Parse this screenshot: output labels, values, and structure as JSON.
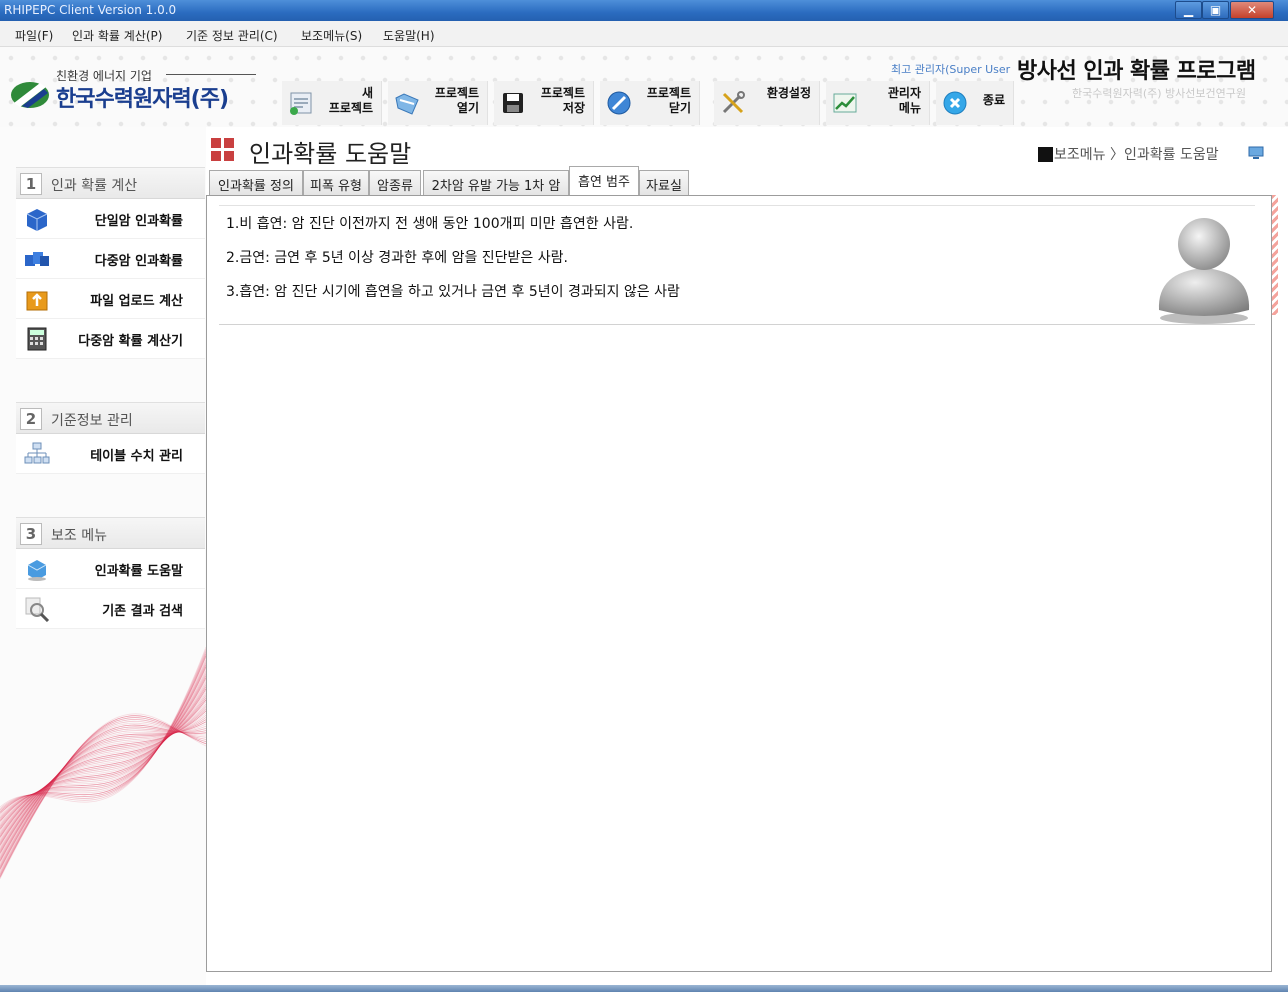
{
  "window": {
    "title": "RHIPEPC Client Version 1.0.0",
    "min_glyph": "▁",
    "max_glyph": "▣",
    "close_glyph": "✕"
  },
  "menubar": [
    "파일(F)",
    "인과 확률 계산(P)",
    "기준 정보 관리(C)",
    "보조메뉴(S)",
    "도움말(H)"
  ],
  "header": {
    "logo_tagline": "친환경 에너지 기업",
    "logo_name": "한국수력원자력(주)",
    "user_label": "최고 관리자(Super User",
    "program_title": "방사선 인과 확률 프로그램",
    "program_subtitle": "한국수력원자력(주) 방사선보건연구원"
  },
  "toolbar": [
    {
      "label": "새\n프로젝트",
      "icon": "new-project-icon"
    },
    {
      "label": "프로젝트\n열기",
      "icon": "open-folder-icon"
    },
    {
      "label": "프로젝트\n저장",
      "icon": "save-disk-icon"
    },
    {
      "label": "프로젝트\n닫기",
      "icon": "close-circle-icon"
    },
    {
      "label": "환경설정",
      "icon": "tools-icon"
    },
    {
      "label": "관리자\n메뉴",
      "icon": "chart-icon"
    },
    {
      "label": "종료",
      "icon": "exit-icon"
    }
  ],
  "sidebar": {
    "sections": [
      {
        "num": "1",
        "label": "인과 확률 계산",
        "items": [
          "단일암 인과확률",
          "다중암 인과확률",
          "파일 업로드 계산",
          "다중암 확률 계산기"
        ]
      },
      {
        "num": "2",
        "label": "기준정보 관리",
        "items": [
          "테이블 수치 관리"
        ]
      },
      {
        "num": "3",
        "label": "보조 메뉴",
        "items": [
          "인과확률 도움말",
          "기존 결과 검색"
        ]
      }
    ]
  },
  "page": {
    "title": "인과확률 도움말",
    "breadcrumb": "보조메뉴 〉인과확률 도움말"
  },
  "tabs": [
    {
      "label": "인과확률 정의",
      "active": false
    },
    {
      "label": "피폭 유형",
      "active": false
    },
    {
      "label": "암종류",
      "active": false
    },
    {
      "label": "2차암 유발 가능 1차 암",
      "active": false
    },
    {
      "label": "흡연 범주",
      "active": true
    },
    {
      "label": "자료실",
      "active": false
    }
  ],
  "content": {
    "lines": [
      "1.비 흡연: 암 진단 이전까지 전 생애 동안 100개피 미만 흡연한 사람.",
      "2.금연: 금연 후 5년 이상 경과한 후에 암을 진단받은 사람.",
      "3.흡연: 암 진단 시기에 흡연을 하고 있거나 금연 후 5년이 경과되지 않은 사람"
    ]
  },
  "colors": {
    "titlebar": "#2b6cc0",
    "logo_blue": "#1a3e8f",
    "swirl_red": "#d8264a",
    "page_icon_red": "#c94040"
  }
}
